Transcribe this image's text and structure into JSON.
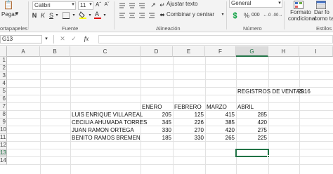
{
  "ribbon": {
    "paste_label": "Pegar",
    "clipboard_group": "ortapapeles",
    "font_name": "Calibri",
    "font_size": "11",
    "bold": "N",
    "italic": "K",
    "underline": "S",
    "font_group": "Fuente",
    "wrap_text": "Ajustar texto",
    "merge_center": "Combinar y centrar",
    "alignment_group": "Alineación",
    "number_format": "General",
    "number_group": "Número",
    "conditional_format": "Formato condicional",
    "format_as_table": "Dar fo como ta",
    "styles_group": "Estilos"
  },
  "formula_bar": {
    "name_box": "G13",
    "fx": "fx",
    "value": ""
  },
  "columns": [
    "A",
    "B",
    "C",
    "D",
    "E",
    "F",
    "G",
    "H",
    "I"
  ],
  "selected_column": "G",
  "rows": [
    "1",
    "2",
    "3",
    "4",
    "5",
    "6",
    "7",
    "8",
    "9",
    "10",
    "11",
    "12",
    "13",
    "14"
  ],
  "selected_row": "13",
  "sheet": {
    "title": "REGISTROS DE VENTAS",
    "year": "2016",
    "headers": [
      "ENERO",
      "FEBRERO",
      "MARZO",
      "ABRIL"
    ],
    "records": [
      {
        "name": "LUIS ENRIQUE VILLAREAL",
        "values": [
          "205",
          "125",
          "415",
          "285"
        ]
      },
      {
        "name": "CECILIA AHUMADA TORRES",
        "values": [
          "345",
          "226",
          "385",
          "420"
        ]
      },
      {
        "name": "JUAN RAMON ORTEGA",
        "values": [
          "330",
          "270",
          "420",
          "275"
        ]
      },
      {
        "name": "BENITO RAMOS BREMEN",
        "values": [
          "185",
          "330",
          "265",
          "225"
        ]
      }
    ]
  }
}
